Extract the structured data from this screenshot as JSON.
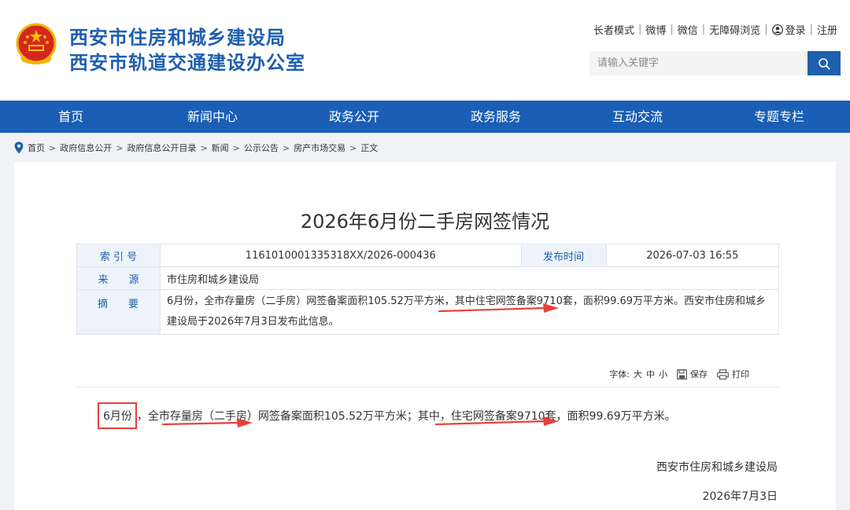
{
  "header": {
    "title_line1": "西安市住房和城乡建设局",
    "title_line2": "西安市轨道交通建设办公室",
    "top_links": [
      "长者模式",
      "微博",
      "微信",
      "无障碍浏览",
      "登录",
      "注册"
    ],
    "search_placeholder": "请输入关键字"
  },
  "nav": [
    "首页",
    "新闻中心",
    "政务公开",
    "政务服务",
    "互动交流",
    "专题专栏"
  ],
  "breadcrumb": [
    "首页",
    "政府信息公开",
    "政府信息公开目录",
    "新闻",
    "公示公告",
    "房产市场交易",
    "正文"
  ],
  "article": {
    "title": "2026年6月份二手房网签情况",
    "index_label": "索 引 号",
    "index_value": "1161010001335318XX/2026-000436",
    "date_label": "发布时间",
    "date_value": "2026-07-03 16:55",
    "source_label": "来　　源",
    "source_value": "市住房和城乡建设局",
    "abstract_label": "摘　　要",
    "abstract_value": "6月份，全市存量房（二手房）网签备案面积105.52万平方米，其中住宅网签备案9710套，面积99.69万平方米。西安市住房和城乡建设局于2026年7月3日发布此信息。",
    "tools": {
      "font_label": "字体:",
      "sizes": [
        "大",
        "中",
        "小"
      ],
      "save": "保存",
      "print": "打印"
    },
    "body_highlight": "6月份",
    "body_rest": "，全市存量房（二手房）网签备案面积105.52万平方米；其中，住宅网签备案9710套，面积99.69万平方米。",
    "signature_org": "西安市住房和城乡建设局",
    "signature_date": "2026年7月3日"
  },
  "colors": {
    "brand_blue": "#1f5fae",
    "nav_blue": "#1a5eb5",
    "annotation_red": "#e8413b"
  }
}
